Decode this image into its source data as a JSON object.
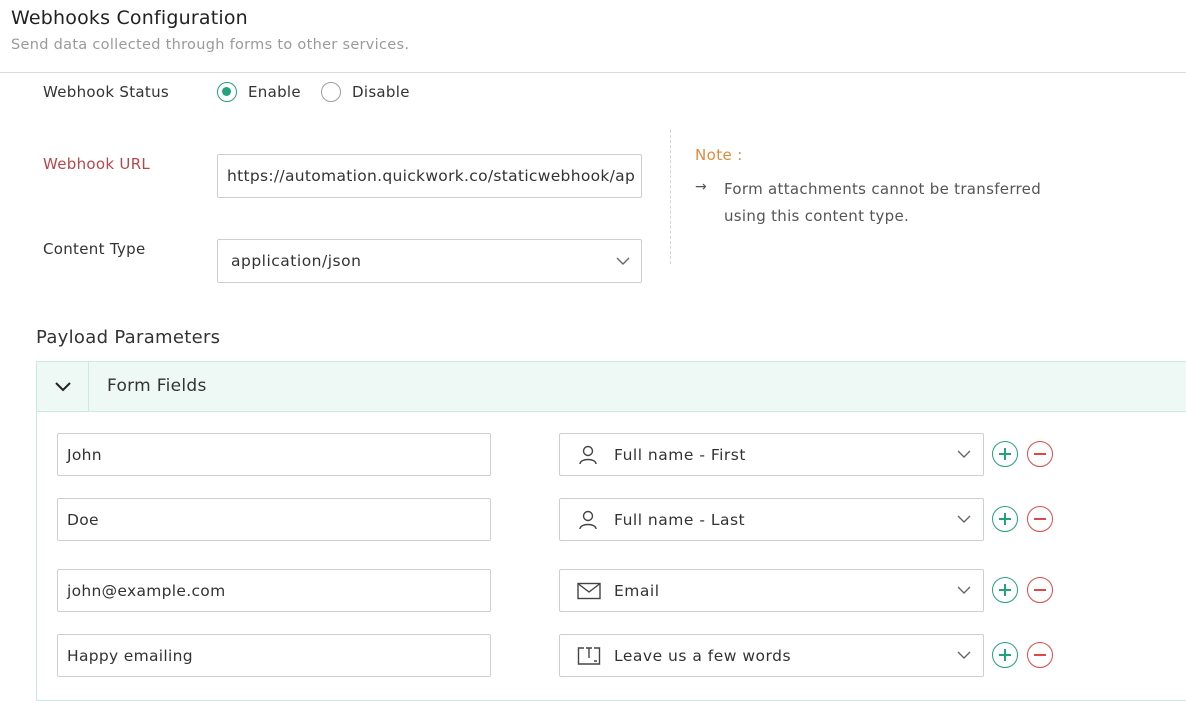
{
  "header": {
    "title": "Webhooks Configuration",
    "subtitle": "Send data collected through forms to other services."
  },
  "status": {
    "label": "Webhook Status",
    "options": [
      {
        "label": "Enable",
        "selected": true
      },
      {
        "label": "Disable",
        "selected": false
      }
    ]
  },
  "url": {
    "label": "Webhook URL",
    "value": "https://automation.quickwork.co/staticwebhook/ap"
  },
  "content_type": {
    "label": "Content Type",
    "value": "application/json"
  },
  "note": {
    "title": "Note :",
    "arrow": "→",
    "text": "Form attachments cannot be transferred using this content type."
  },
  "payload": {
    "title": "Payload Parameters",
    "section_title": "Form Fields",
    "rows": [
      {
        "value": "John",
        "field": "Full name - First",
        "icon": "person-icon"
      },
      {
        "value": "Doe",
        "field": "Full name - Last",
        "icon": "person-icon"
      },
      {
        "value": "john@example.com",
        "field": "Email",
        "icon": "envelope-icon"
      },
      {
        "value": "Happy emailing",
        "field": "Leave us a few words",
        "icon": "textarea-icon"
      }
    ]
  },
  "colors": {
    "accent": "#23a37a",
    "remove": "#e04848",
    "required_label": "#b5474b",
    "note_title": "#e08a3c",
    "panel_header_bg": "#eef8f5"
  }
}
